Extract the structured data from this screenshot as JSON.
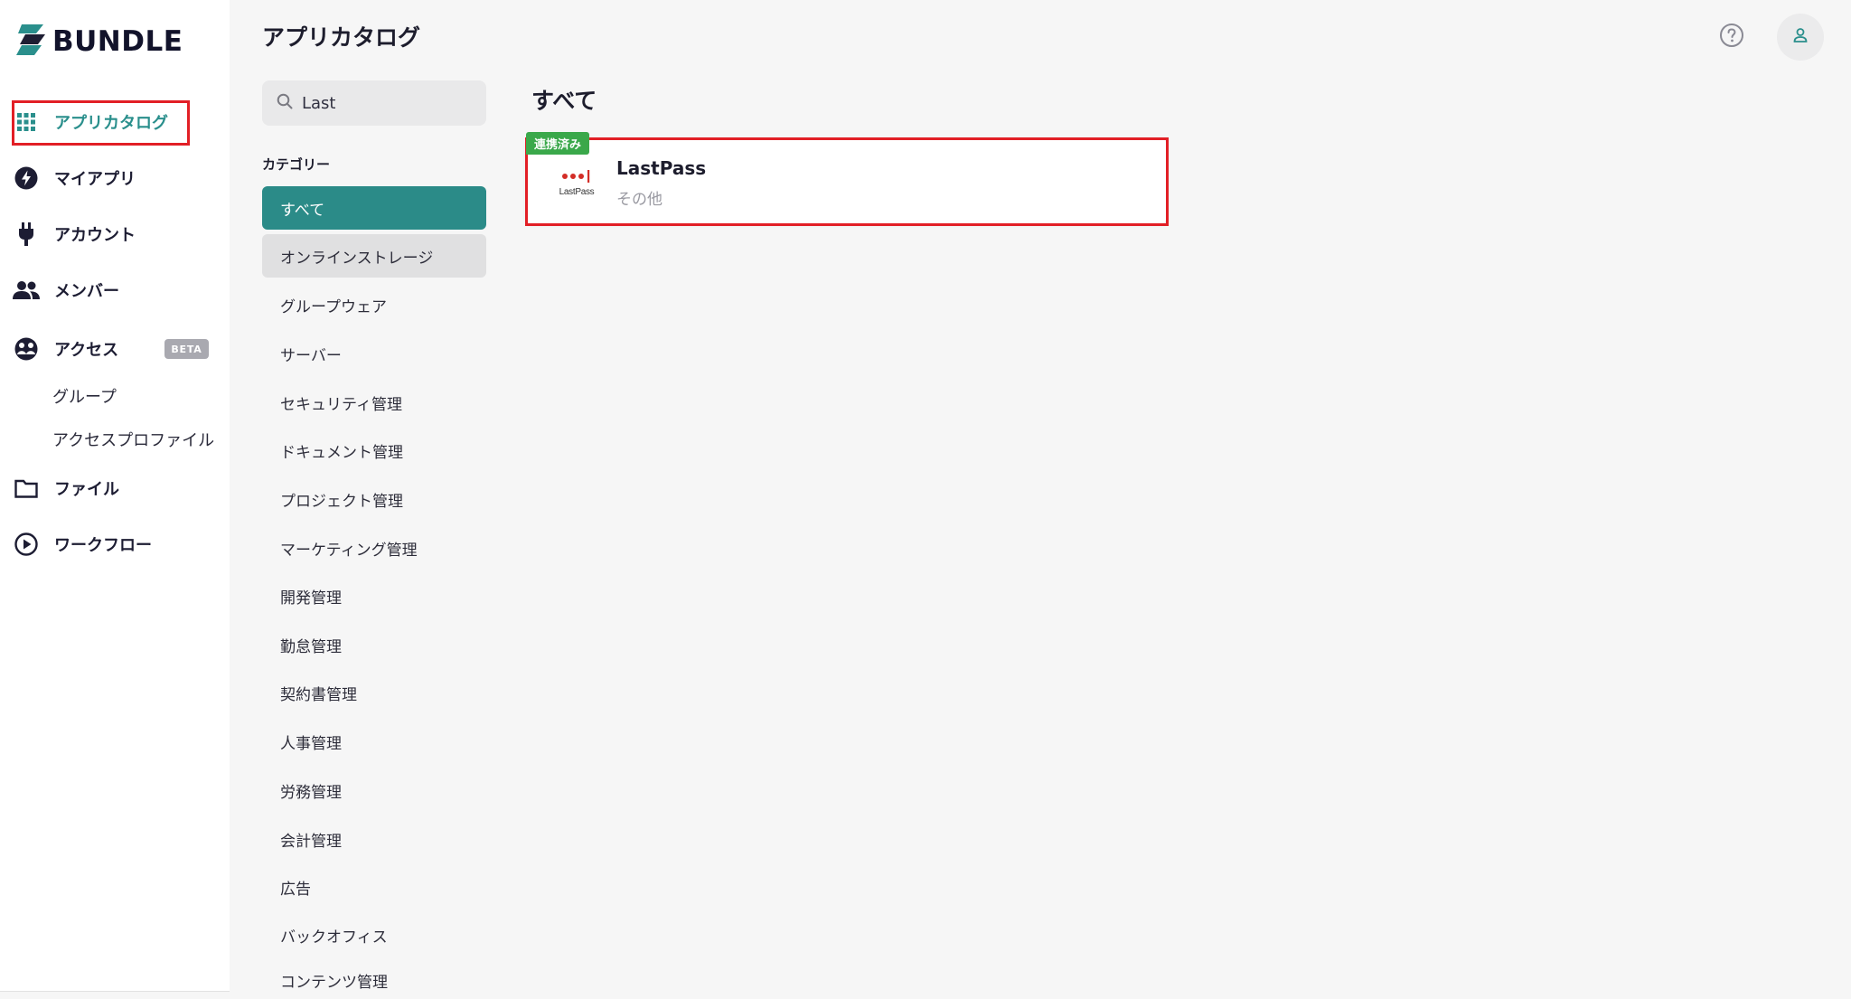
{
  "brand": {
    "name": "BUNDLE",
    "accent": "#2a8f8c",
    "highlight": "#e21f26",
    "badge_green": "#3aa84a"
  },
  "sidebar": {
    "items": [
      {
        "label": "アプリカタログ",
        "icon": "grid-icon",
        "active": true
      },
      {
        "label": "マイアプリ",
        "icon": "bolt-icon"
      },
      {
        "label": "アカウント",
        "icon": "plug-icon"
      },
      {
        "label": "メンバー",
        "icon": "people-icon"
      },
      {
        "label": "アクセス",
        "icon": "access-icon",
        "badge": "BETA"
      },
      {
        "label": "ファイル",
        "icon": "folder-icon"
      },
      {
        "label": "ワークフロー",
        "icon": "play-circle-icon"
      }
    ],
    "access_sub": [
      "グループ",
      "アクセスプロファイル"
    ]
  },
  "header": {
    "title": "アプリカタログ"
  },
  "search": {
    "value": "Last"
  },
  "categories": {
    "title": "カテゴリー",
    "items": [
      "すべて",
      "オンラインストレージ",
      "グループウェア",
      "サーバー",
      "セキュリティ管理",
      "ドキュメント管理",
      "プロジェクト管理",
      "マーケティング管理",
      "開発管理",
      "勤怠管理",
      "契約書管理",
      "人事管理",
      "労務管理",
      "会計管理",
      "広告",
      "バックオフィス",
      "コンテンツ管理"
    ]
  },
  "results": {
    "heading": "すべて",
    "apps": [
      {
        "name": "LastPass",
        "category": "その他",
        "badge": "連携済み",
        "logo_text": "LastPass"
      }
    ]
  }
}
